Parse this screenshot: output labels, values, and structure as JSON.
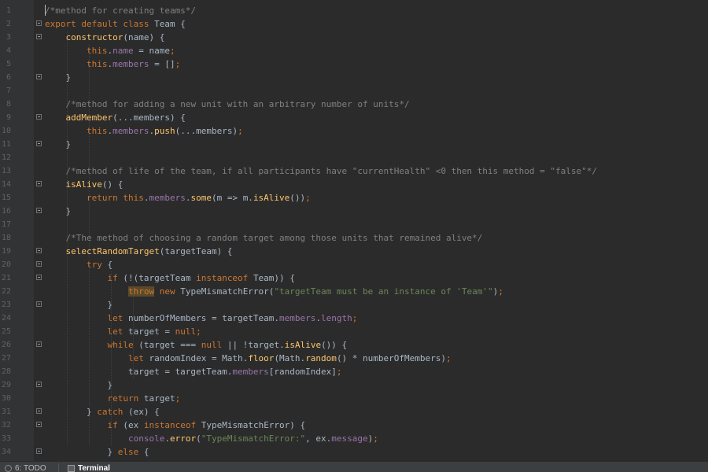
{
  "colors": {
    "background": "#2b2b2b",
    "keyword": "#cc7832",
    "comment": "#808080",
    "function": "#ffc66d",
    "field": "#9876aa",
    "string": "#6a8759",
    "text": "#a9b7c6",
    "line_number": "#606366"
  },
  "editor": {
    "lines": [
      {
        "n": "1",
        "tokens": [
          [
            "c",
            "/*method for creating teams*/"
          ]
        ]
      },
      {
        "n": "2",
        "tokens": [
          [
            "k",
            "export default class "
          ],
          [
            "t",
            "Team {"
          ]
        ]
      },
      {
        "n": "3",
        "tokens": [
          [
            "t",
            "    "
          ],
          [
            "f",
            "constructor"
          ],
          [
            "t",
            "(name) {"
          ]
        ]
      },
      {
        "n": "4",
        "tokens": [
          [
            "t",
            "        "
          ],
          [
            "k",
            "this"
          ],
          [
            "t",
            "."
          ],
          [
            "m",
            "name"
          ],
          [
            "t",
            " = name"
          ],
          [
            "k",
            ";"
          ]
        ]
      },
      {
        "n": "5",
        "tokens": [
          [
            "t",
            "        "
          ],
          [
            "k",
            "this"
          ],
          [
            "t",
            "."
          ],
          [
            "m",
            "members"
          ],
          [
            "t",
            " = []"
          ],
          [
            "k",
            ";"
          ]
        ]
      },
      {
        "n": "6",
        "tokens": [
          [
            "t",
            "    }"
          ]
        ]
      },
      {
        "n": "7",
        "tokens": []
      },
      {
        "n": "8",
        "tokens": [
          [
            "t",
            "    "
          ],
          [
            "c",
            "/*method for adding a new unit with an arbitrary number of units*/"
          ]
        ]
      },
      {
        "n": "9",
        "tokens": [
          [
            "t",
            "    "
          ],
          [
            "f",
            "addMember"
          ],
          [
            "t",
            "(...members) {"
          ]
        ]
      },
      {
        "n": "10",
        "tokens": [
          [
            "t",
            "        "
          ],
          [
            "k",
            "this"
          ],
          [
            "t",
            "."
          ],
          [
            "m",
            "members"
          ],
          [
            "t",
            "."
          ],
          [
            "f",
            "push"
          ],
          [
            "t",
            "(...members)"
          ],
          [
            "k",
            ";"
          ]
        ]
      },
      {
        "n": "11",
        "tokens": [
          [
            "t",
            "    }"
          ]
        ]
      },
      {
        "n": "12",
        "tokens": []
      },
      {
        "n": "13",
        "tokens": [
          [
            "t",
            "    "
          ],
          [
            "c",
            "/*method of life of the team, if all participants have \"currentHealth\" <0 then this method = \"false\"*/"
          ]
        ]
      },
      {
        "n": "14",
        "tokens": [
          [
            "t",
            "    "
          ],
          [
            "f",
            "isAlive"
          ],
          [
            "t",
            "() {"
          ]
        ]
      },
      {
        "n": "15",
        "tokens": [
          [
            "t",
            "        "
          ],
          [
            "k",
            "return this"
          ],
          [
            "t",
            "."
          ],
          [
            "m",
            "members"
          ],
          [
            "t",
            "."
          ],
          [
            "f",
            "some"
          ],
          [
            "t",
            "(m => m."
          ],
          [
            "f",
            "isAlive"
          ],
          [
            "t",
            "())"
          ],
          [
            "k",
            ";"
          ]
        ]
      },
      {
        "n": "16",
        "tokens": [
          [
            "t",
            "    }"
          ]
        ]
      },
      {
        "n": "17",
        "tokens": []
      },
      {
        "n": "18",
        "tokens": [
          [
            "t",
            "    "
          ],
          [
            "c",
            "/*The method of choosing a random target among those units that remained alive*/"
          ]
        ]
      },
      {
        "n": "19",
        "tokens": [
          [
            "t",
            "    "
          ],
          [
            "f",
            "selectRandomTarget"
          ],
          [
            "t",
            "(targetTeam) {"
          ]
        ]
      },
      {
        "n": "20",
        "tokens": [
          [
            "t",
            "        "
          ],
          [
            "k",
            "try "
          ],
          [
            "t",
            "{"
          ]
        ]
      },
      {
        "n": "21",
        "tokens": [
          [
            "t",
            "            "
          ],
          [
            "k",
            "if "
          ],
          [
            "t",
            "(!(targetTeam "
          ],
          [
            "k",
            "instanceof "
          ],
          [
            "t",
            "Team)) {"
          ]
        ]
      },
      {
        "n": "22",
        "tokens": [
          [
            "t",
            "                "
          ],
          [
            "h",
            "throw"
          ],
          [
            "t",
            " "
          ],
          [
            "k",
            "new "
          ],
          [
            "t",
            "TypeMismatchError("
          ],
          [
            "s",
            "\"targetTeam must be an instance of 'Team'\""
          ],
          [
            "t",
            ")"
          ],
          [
            "k",
            ";"
          ]
        ]
      },
      {
        "n": "23",
        "tokens": [
          [
            "t",
            "            }"
          ]
        ]
      },
      {
        "n": "24",
        "tokens": [
          [
            "t",
            "            "
          ],
          [
            "k",
            "let "
          ],
          [
            "t",
            "numberOfMembers = targetTeam."
          ],
          [
            "m",
            "members"
          ],
          [
            "t",
            "."
          ],
          [
            "m",
            "length"
          ],
          [
            "k",
            ";"
          ]
        ]
      },
      {
        "n": "25",
        "tokens": [
          [
            "t",
            "            "
          ],
          [
            "k",
            "let "
          ],
          [
            "t",
            "target = "
          ],
          [
            "k",
            "null;"
          ]
        ]
      },
      {
        "n": "26",
        "tokens": [
          [
            "t",
            "            "
          ],
          [
            "k",
            "while "
          ],
          [
            "t",
            "(target === "
          ],
          [
            "k",
            "null "
          ],
          [
            "t",
            "|| !target."
          ],
          [
            "f",
            "isAlive"
          ],
          [
            "t",
            "()) {"
          ]
        ]
      },
      {
        "n": "27",
        "tokens": [
          [
            "t",
            "                "
          ],
          [
            "k",
            "let "
          ],
          [
            "t",
            "randomIndex = Math."
          ],
          [
            "f",
            "floor"
          ],
          [
            "t",
            "(Math."
          ],
          [
            "f",
            "random"
          ],
          [
            "t",
            "() * numberOfMembers)"
          ],
          [
            "k",
            ";"
          ]
        ]
      },
      {
        "n": "28",
        "tokens": [
          [
            "t",
            "                target = targetTeam."
          ],
          [
            "m",
            "members"
          ],
          [
            "t",
            "[randomIndex]"
          ],
          [
            "k",
            ";"
          ]
        ]
      },
      {
        "n": "29",
        "tokens": [
          [
            "t",
            "            }"
          ]
        ]
      },
      {
        "n": "30",
        "tokens": [
          [
            "t",
            "            "
          ],
          [
            "k",
            "return "
          ],
          [
            "t",
            "target"
          ],
          [
            "k",
            ";"
          ]
        ]
      },
      {
        "n": "31",
        "tokens": [
          [
            "t",
            "        } "
          ],
          [
            "k",
            "catch "
          ],
          [
            "t",
            "(ex) {"
          ]
        ]
      },
      {
        "n": "32",
        "tokens": [
          [
            "t",
            "            "
          ],
          [
            "k",
            "if "
          ],
          [
            "t",
            "(ex "
          ],
          [
            "k",
            "instanceof "
          ],
          [
            "t",
            "TypeMismatchError) {"
          ]
        ]
      },
      {
        "n": "33",
        "tokens": [
          [
            "t",
            "                "
          ],
          [
            "m",
            "console"
          ],
          [
            "t",
            "."
          ],
          [
            "f",
            "error"
          ],
          [
            "t",
            "("
          ],
          [
            "s",
            "\"TypeMismatchError:\""
          ],
          [
            "t",
            ", ex."
          ],
          [
            "m",
            "message"
          ],
          [
            "t",
            ")"
          ],
          [
            "k",
            ";"
          ]
        ]
      },
      {
        "n": "34",
        "tokens": [
          [
            "t",
            "            } "
          ],
          [
            "k",
            "else "
          ],
          [
            "t",
            "{"
          ]
        ]
      }
    ]
  },
  "statusbar": {
    "todo_label": "6: TODO",
    "terminal_label": "Terminal"
  }
}
